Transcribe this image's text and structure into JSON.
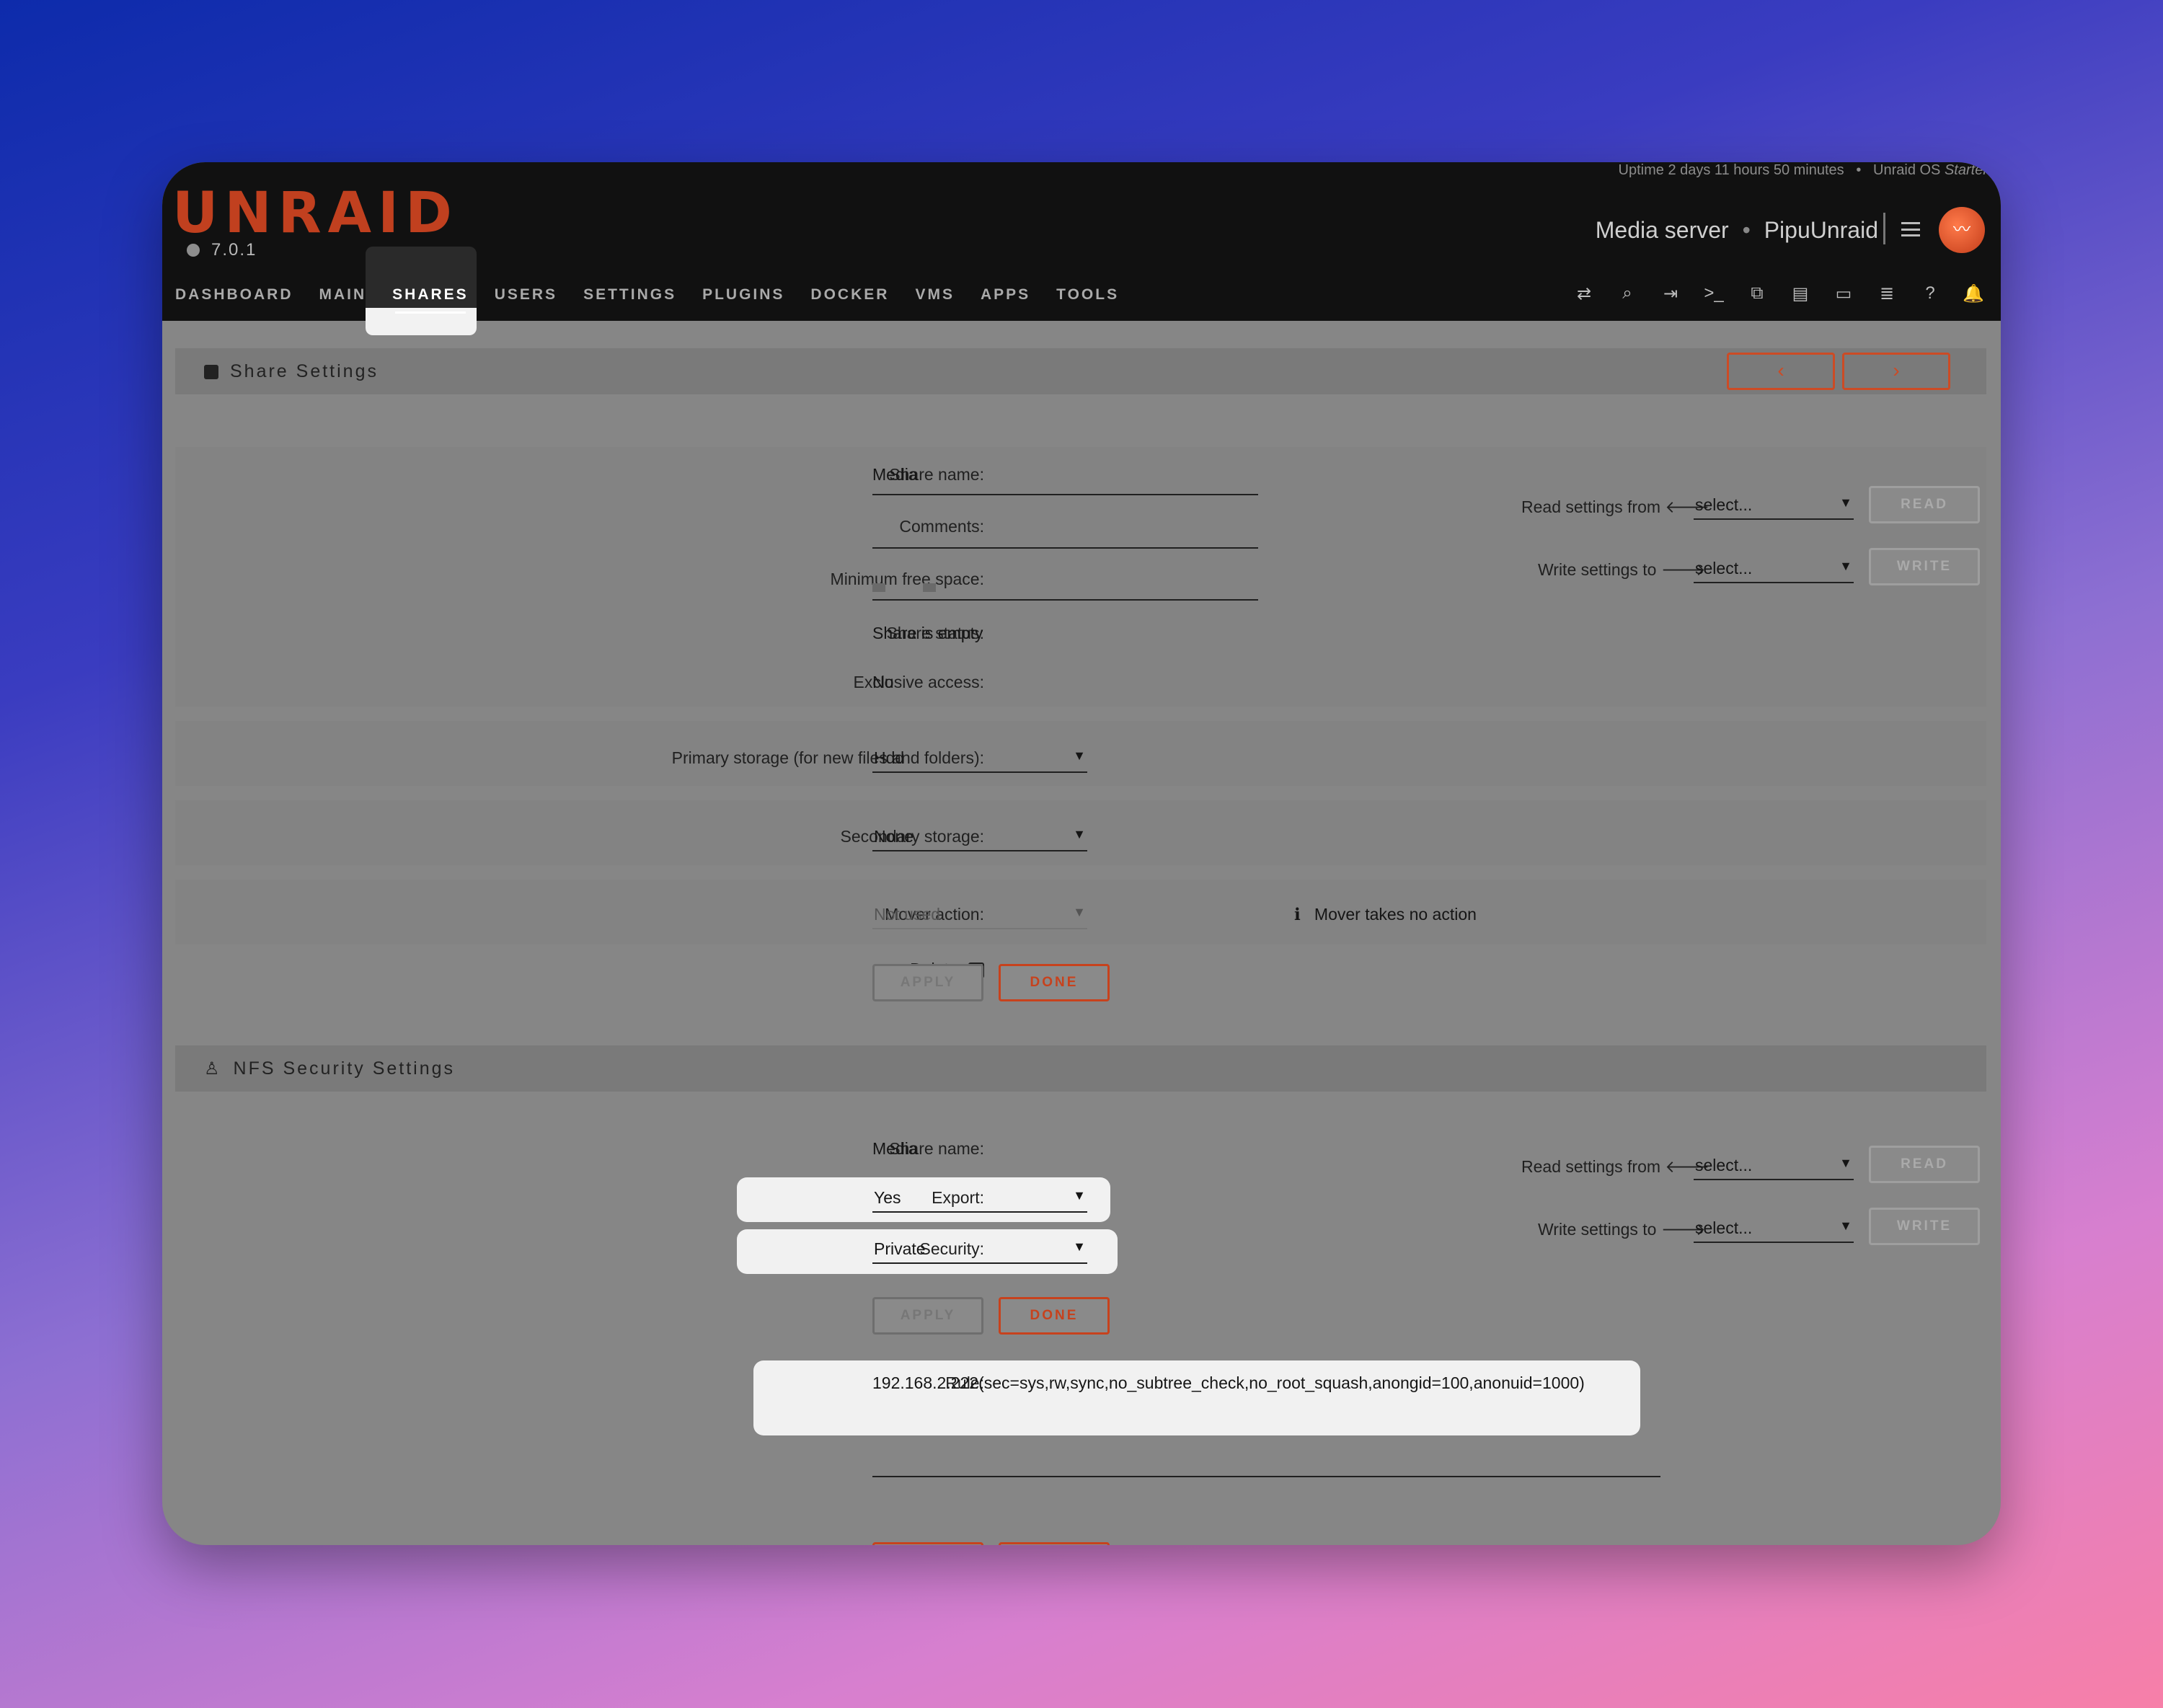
{
  "header": {
    "logo": "UNRAID",
    "version": "7.0.1",
    "uptime": "Uptime 2 days 11 hours 50 minutes",
    "uptime_sep": "•",
    "os": "Unraid OS",
    "license": "Starter",
    "server_desc": "Media server",
    "server_sep": "•",
    "server_name": "PipuUnraid"
  },
  "nav": {
    "dashboard": "DASHBOARD",
    "main": "MAIN",
    "shares": "SHARES",
    "users": "USERS",
    "settings": "SETTINGS",
    "plugins": "PLUGINS",
    "docker": "DOCKER",
    "vms": "VMS",
    "apps": "APPS",
    "tools": "TOOLS"
  },
  "toolbar_icons": [
    "swap-icon",
    "search-icon",
    "logout-icon",
    "terminal-icon",
    "copy-icon",
    "feedback-icon",
    "display-icon",
    "log-icon",
    "help-icon",
    "bell-icon"
  ],
  "share_settings": {
    "title": "Share Settings",
    "prev": "‹",
    "next": "›",
    "share_name_label": "Share name:",
    "share_name_value": "Media",
    "comments_label": "Comments:",
    "comments_value": "",
    "min_free_label": "Minimum free space:",
    "status_label": "Share status:",
    "status_value": "Share is empty",
    "exclusive_label": "Exclusive access:",
    "exclusive_value": "No",
    "primary_label": "Primary storage (for new files and folders):",
    "primary_value": "Hdd",
    "secondary_label": "Secondary storage:",
    "secondary_value": "None",
    "mover_label": "Mover action:",
    "mover_value": "Not used",
    "mover_info": "Mover takes no action",
    "delete_label": "Delete",
    "apply": "APPLY",
    "done": "DONE",
    "read_from_label": "Read settings from",
    "write_to_label": "Write settings to",
    "select_placeholder": "select...",
    "read_btn": "READ",
    "write_btn": "WRITE"
  },
  "nfs": {
    "title": "NFS Security Settings",
    "share_name_label": "Share name:",
    "share_name_value": "Media",
    "export_label": "Export:",
    "export_value": "Yes",
    "security_label": "Security:",
    "security_value": "Private",
    "apply": "APPLY",
    "done": "DONE",
    "rule_label": "Rule:",
    "rule_value": "192.168.2.222(sec=sys,rw,sync,no_subtree_check,no_root_squash,anongid=100,anonuid=1000)",
    "read_from_label": "Read settings from",
    "write_to_label": "Write settings to",
    "select_placeholder": "select...",
    "read_btn": "READ",
    "write_btn": "WRITE"
  },
  "colors": {
    "brand": "#c1401f",
    "accent_button": "#c7421d",
    "notification": "#e5a01d"
  }
}
